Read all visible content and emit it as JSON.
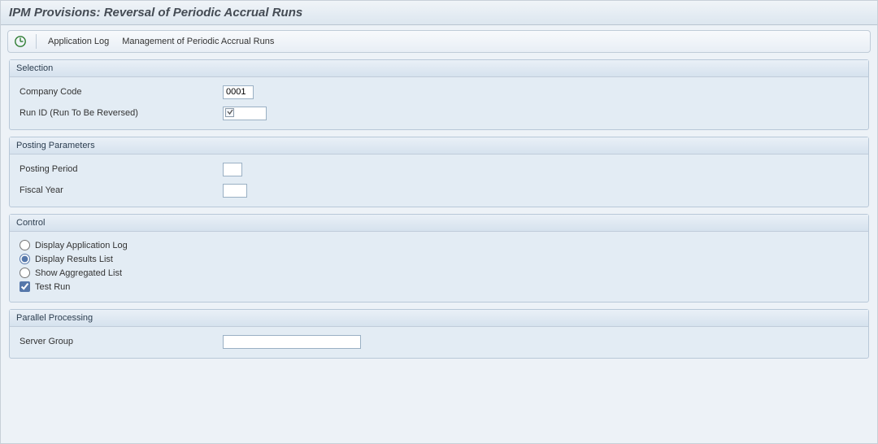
{
  "title": "IPM Provisions: Reversal of Periodic Accrual Runs",
  "toolbar": {
    "exec_icon": "execute-icon",
    "app_log_label": "Application Log",
    "mgmt_label": "Management of Periodic Accrual Runs"
  },
  "groups": {
    "selection": {
      "title": "Selection",
      "company_code_label": "Company Code",
      "company_code_value": "0001",
      "run_id_label": "Run ID (Run To Be Reversed)",
      "run_id_value": ""
    },
    "posting": {
      "title": "Posting Parameters",
      "posting_period_label": "Posting Period",
      "posting_period_value": "",
      "fiscal_year_label": "Fiscal Year",
      "fiscal_year_value": ""
    },
    "control": {
      "title": "Control",
      "opt_display_log": "Display Application Log",
      "opt_display_results": "Display Results List",
      "opt_show_aggregated": "Show Aggregated List",
      "chk_test_run": "Test Run",
      "selected_radio": "opt_display_results",
      "test_run_checked": true
    },
    "parallel": {
      "title": "Parallel Processing",
      "server_group_label": "Server Group",
      "server_group_value": ""
    }
  }
}
